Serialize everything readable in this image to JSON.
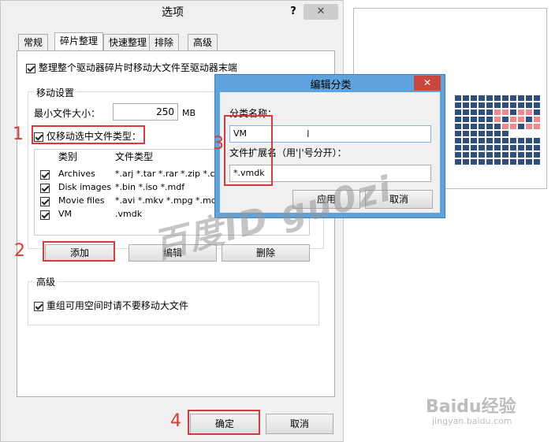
{
  "window": {
    "title": "选项",
    "help": "?",
    "close": "✕"
  },
  "tabs": [
    {
      "label": "常规"
    },
    {
      "label": "碎片整理"
    },
    {
      "label": "快速整理"
    },
    {
      "label": "排除"
    },
    {
      "label": "高级"
    }
  ],
  "panel": {
    "move_large_label": "整理整个驱动器碎片时移动大文件至驱动器末端",
    "move_settings_title": "移动设置",
    "min_size_label": "最小文件大小：",
    "min_size_value": "250",
    "min_size_unit": "MB",
    "only_selected_label": "仅移动选中文件类型：",
    "columns": {
      "category": "类别",
      "types": "文件类型"
    },
    "rows": [
      {
        "category": "Archives",
        "types": "*.arj *.tar *.rar *.zip *.ca",
        "checked": true
      },
      {
        "category": "Disk images",
        "types": "*.bin *.iso *.mdf",
        "checked": true
      },
      {
        "category": "Movie files",
        "types": "*.avi *.mkv *.mpg *.mov",
        "checked": true
      },
      {
        "category": "VM",
        "types": ".vmdk",
        "checked": true
      }
    ],
    "add_button": "添加",
    "edit_button": "编辑",
    "delete_button": "删除",
    "advanced_title": "高级",
    "reorg_label": "重组可用空间时请不要移动大文件"
  },
  "footer": {
    "ok_button": "确定",
    "cancel_button": "取消"
  },
  "edit_dialog": {
    "title": "编辑分类",
    "close": "✕",
    "name_label": "分类名称：",
    "name_value": "VM",
    "ext_label": "文件扩展名（用'|'号分开）：",
    "ext_value": "*.vmdk",
    "apply_button": "应用",
    "cancel_button": "取消"
  },
  "annotations": {
    "n1": "1",
    "n2": "2",
    "n3": "3",
    "n4": "4"
  },
  "watermark": "百度ID  gu0zi",
  "logo": {
    "text": "Baidu经验",
    "sub": "jingyan.baidu.com"
  },
  "disk_map": {
    "rows": 10,
    "cols": 20,
    "colors": {
      "free": "#2f4f7f",
      "used": "#f08a8a",
      "empty": "#ffffff"
    }
  }
}
